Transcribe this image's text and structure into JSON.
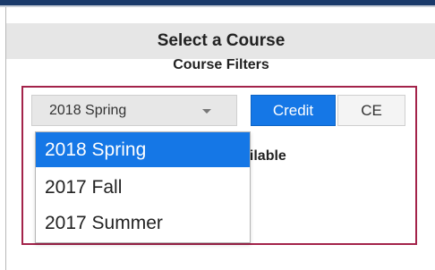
{
  "panel": {
    "title": "Select a Course",
    "filters_title": "Course Filters"
  },
  "filters": {
    "term_select": {
      "value": "2018 Spring",
      "options": [
        "2018 Spring",
        "2017 Fall",
        "2017 Summer"
      ],
      "selected_index": 0
    },
    "credit_label": "Credit",
    "ce_label": "CE",
    "available_fragment": "ailable"
  },
  "colors": {
    "accent": "#1577e6",
    "filter_border": "#a3234a",
    "header_bg": "#e6e6e6"
  }
}
